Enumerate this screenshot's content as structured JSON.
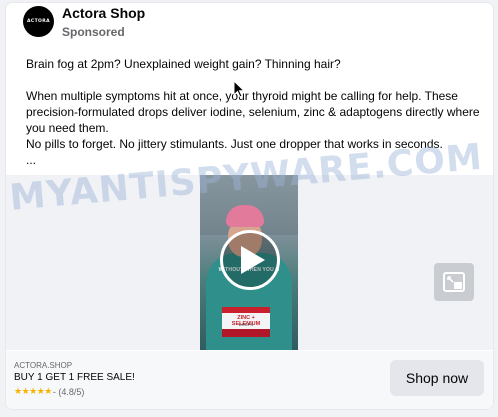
{
  "post": {
    "page_name": "Actora Shop",
    "avatar_text": "ACTORA",
    "sponsored_label": "Sponsored",
    "body": {
      "line1": "Brain fog at 2pm? Unexplained weight gain? Thinning hair?",
      "line2": "When multiple symptoms hit at once, your thyroid might be calling for help. These precision-formulated drops deliver iodine, selenium, zinc & adaptogens directly where you need them.",
      "line3": "No pills to forget. No jittery stimulants. Just one dropper that works in seconds.",
      "line4": "..."
    }
  },
  "media": {
    "video_caption": "WITHOUT WHEN YOU B",
    "product_label_line1": "ZINC + SELENIUM",
    "product_label_line2": "DROPS",
    "play_icon": "play-icon",
    "pip_icon": "picture-in-picture-icon"
  },
  "footer": {
    "domain": "ACTORA.SHOP",
    "headline": "BUY 1 GET 1 FREE SALE!",
    "stars": "★★★★★",
    "rating_text": "- (4.8/5)",
    "cta_label": "Shop now"
  },
  "watermark": "MYANTISPYWARE.COM",
  "colors": {
    "card_background": "#ffffff",
    "page_background": "#f0f2f5",
    "button_background": "#e4e6eb",
    "star_color": "#f4b400",
    "secondary_text": "#65676b"
  }
}
